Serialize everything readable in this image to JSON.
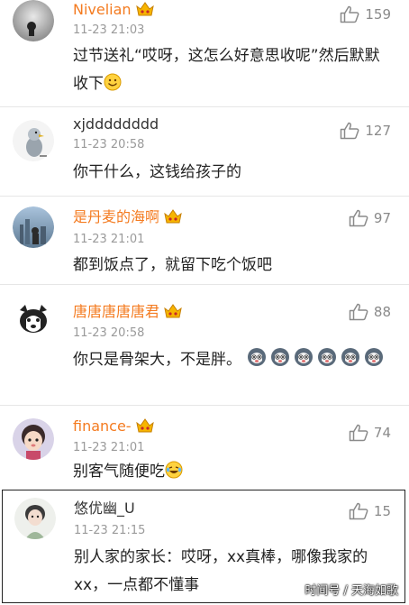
{
  "comments": [
    {
      "name": "Nivelian",
      "time": "11-23 21:03",
      "text": "过节送礼“哎呀，这怎么好意思收呢”然后默默收下",
      "likes": "159",
      "name_color": "#f47b20",
      "icon": "smile-emoji-icon"
    },
    {
      "name": "xjdddddddd",
      "time": "11-23 20:58",
      "text": "你干什么，这钱给孩子的",
      "likes": "127",
      "name_color": "#333333"
    },
    {
      "name": "是丹麦的海啊",
      "time": "11-23 21:01",
      "text": "都到饭点了，就留下吃个饭吧",
      "likes": "97",
      "name_color": "#f47b20"
    },
    {
      "name": "唐唐唐唐唐君",
      "time": "11-23 20:58",
      "text": "你只是骨架大，不是胖。",
      "likes": "88",
      "name_color": "#f47b20",
      "icon": "husky-emoji-icon"
    },
    {
      "name": "finance-",
      "time": "11-23 21:01",
      "text": "别客气随便吃",
      "likes": "74",
      "name_color": "#f47b20",
      "icon": "laughing-tears-emoji-icon"
    },
    {
      "name": "悠优幽_U",
      "time": "11-23 21:15",
      "text": "别人家的家长：哎呀，xx真棒，哪像我家的xx，一点都不懂事",
      "likes": "15",
      "name_color": "#333333"
    }
  ],
  "watermark": "时间号 / 天海如歌"
}
